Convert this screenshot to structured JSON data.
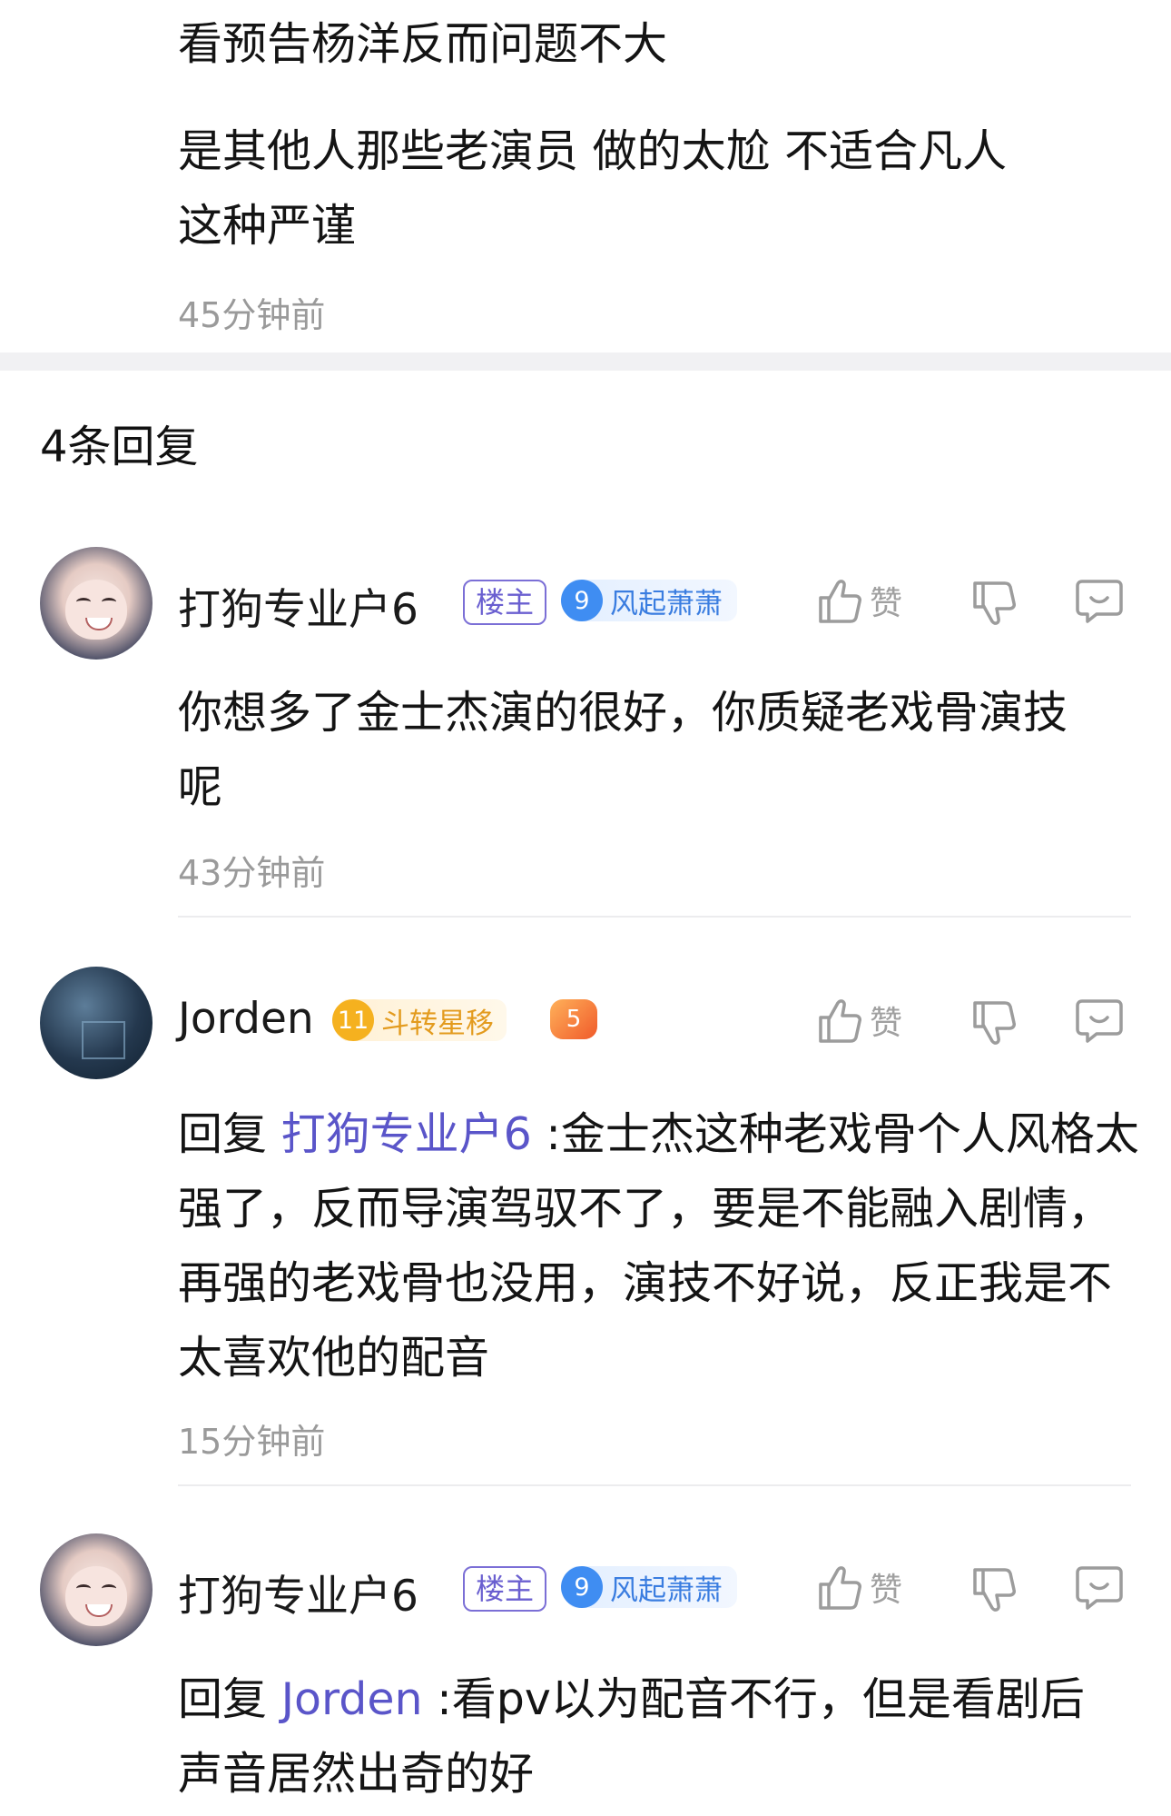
{
  "top_comment": {
    "lines": [
      "看预告杨洋反而问题不大",
      "是其他人那些老演员 做的太尬 不适合凡人",
      "这种严谨"
    ],
    "time": "45分钟前"
  },
  "replies_header": "4条回复",
  "like_label": "赞",
  "replies": [
    {
      "name": "打狗专业户6",
      "owner_tag": "楼主",
      "fan_level": "9",
      "fan_title": "风起萧萧",
      "text": "你想多了金士杰演的很好，你质疑老戏骨演技呢",
      "time": "43分钟前"
    },
    {
      "name": "Jorden",
      "fan_level": "11",
      "fan_title": "斗转星移",
      "game_badge": "5",
      "reply_prefix": "回复",
      "mention": "打狗专业户6",
      "text": ":金士杰这种老戏骨个人风格太强了，反而导演驾驭不了，要是不能融入剧情，再强的老戏骨也没用，演技不好说，反正我是不太喜欢他的配音",
      "time": "15分钟前"
    },
    {
      "name": "打狗专业户6",
      "owner_tag": "楼主",
      "fan_level": "9",
      "fan_title": "风起萧萧",
      "reply_prefix": "回复",
      "mention": "Jorden",
      "text": ":看pv以为配音不行，但是看剧后声音居然出奇的好"
    }
  ],
  "colors": {
    "mention": "#5a55c9",
    "owner_tag": "#6a5fd0",
    "fan_blue": "#3a7de0",
    "fan_gold": "#e39b1e",
    "time": "#9a9a9a"
  }
}
